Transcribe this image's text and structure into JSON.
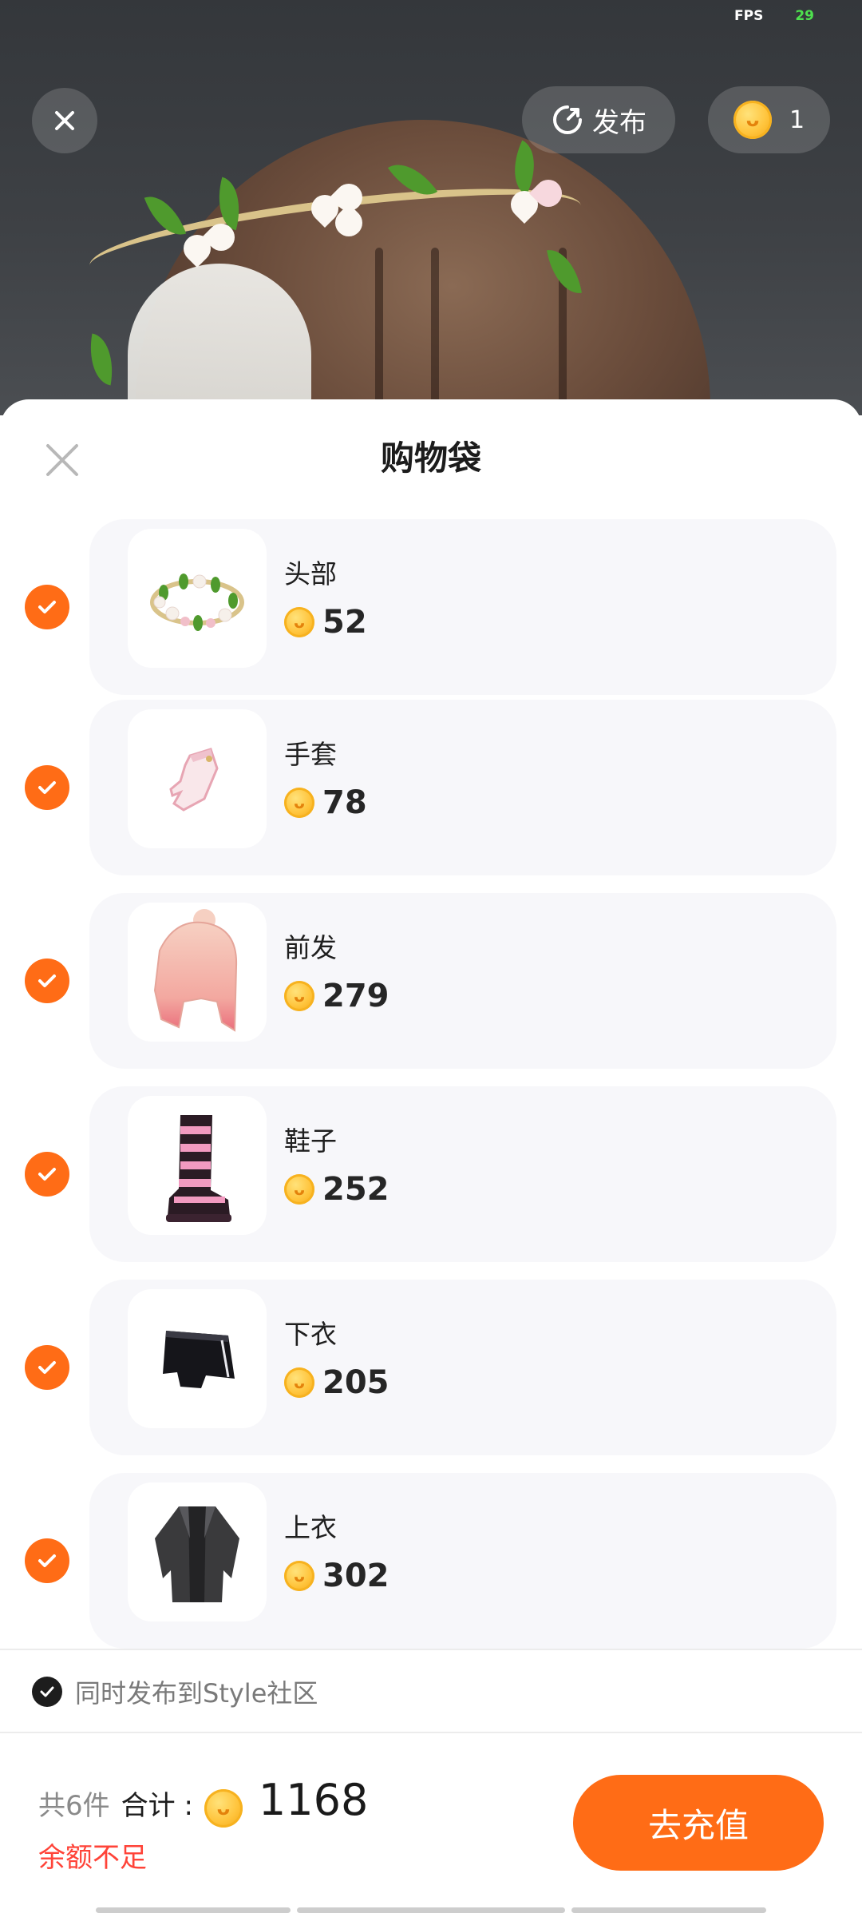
{
  "fps": {
    "label": "FPS",
    "value": "29"
  },
  "topbar": {
    "publish_label": "发布",
    "coin_balance": "1"
  },
  "sheet": {
    "title": "购物袋"
  },
  "items": [
    {
      "name": "头部",
      "price": "52"
    },
    {
      "name": "手套",
      "price": "78"
    },
    {
      "name": "前发",
      "price": "279"
    },
    {
      "name": "鞋子",
      "price": "252"
    },
    {
      "name": "下衣",
      "price": "205"
    },
    {
      "name": "上衣",
      "price": "302"
    }
  ],
  "community": {
    "label": "同时发布到Style社区",
    "checked": true
  },
  "summary": {
    "count": "共6件",
    "total_label": "合计 :",
    "total_value": "1168",
    "warning": "余额不足"
  },
  "actions": {
    "recharge_label": "去充值"
  },
  "colors": {
    "accent": "#ff6c16",
    "warning": "#ff4338",
    "fps": "#4ee04e"
  }
}
